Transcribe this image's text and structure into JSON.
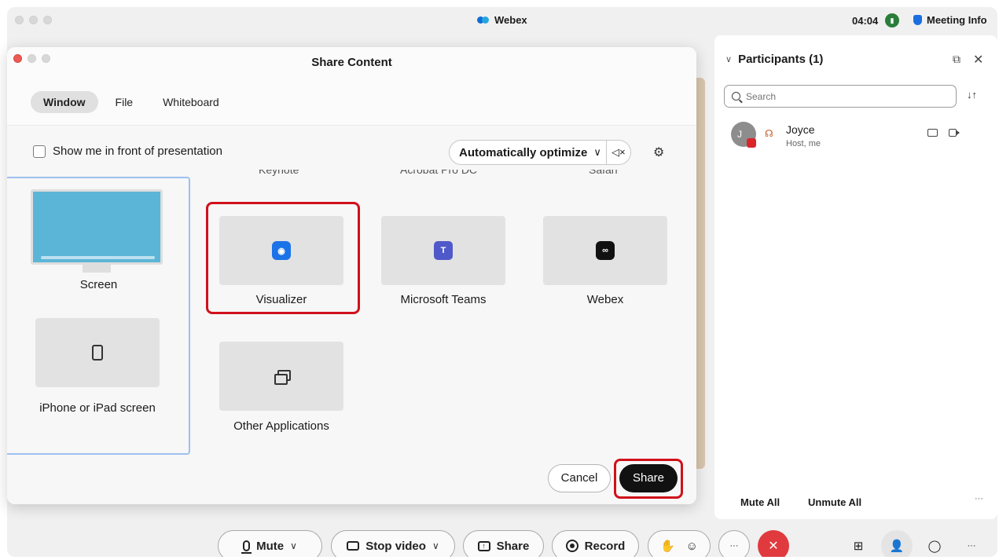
{
  "window": {
    "app_title": "Webex",
    "clock": "04:04",
    "meeting_info": "Meeting Info"
  },
  "participants": {
    "title": "Participants (1)",
    "search_placeholder": "Search",
    "items": [
      {
        "initial": "J",
        "name": "Joyce",
        "role": "Host, me"
      }
    ],
    "mute_all": "Mute All",
    "unmute_all": "Unmute All",
    "more": "···"
  },
  "toolbar": {
    "mute": "Mute",
    "stop_video": "Stop video",
    "share": "Share",
    "record": "Record",
    "more": "···"
  },
  "dialog": {
    "title": "Share Content",
    "tabs": [
      "Window",
      "File",
      "Whiteboard"
    ],
    "active_tab": "Window",
    "show_me_label": "Show me in front of presentation",
    "optimize_label": "Automatically optimize",
    "cut_off_labels": [
      "Keynote",
      "Acrobat Pro DC",
      "Safari"
    ],
    "screen_label": "Screen",
    "iphone_label": "iPhone or iPad screen",
    "apps": [
      {
        "label": "Visualizer",
        "icon": "visualizer-icon"
      },
      {
        "label": "Microsoft Teams",
        "icon": "teams-icon"
      },
      {
        "label": "Webex",
        "icon": "webex-icon"
      },
      {
        "label": "Other Applications",
        "icon": "windows-icon"
      }
    ],
    "cancel": "Cancel",
    "share": "Share"
  },
  "colors": {
    "highlight": "#d0111b",
    "share_button": "#111111",
    "end_call": "#e03a3e",
    "selected_outline": "#9ec1f0"
  }
}
